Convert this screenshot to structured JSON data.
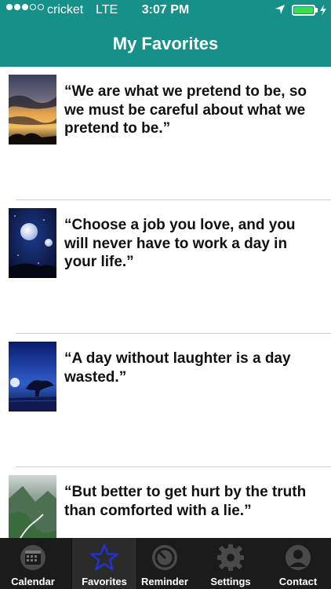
{
  "status_bar": {
    "carrier": "cricket",
    "network": "LTE",
    "time": "3:07 PM",
    "signal_bars_filled": 3,
    "signal_bars_total": 5,
    "battery_level": 1.0,
    "battery_color": "#38e04a"
  },
  "header": {
    "title": "My Favorites",
    "background_color": "#16918a"
  },
  "favorites": [
    {
      "quote": "“We are what we pretend to be, so we must be careful about what we pretend to be.”",
      "image": "sunset-clouds-image"
    },
    {
      "quote": "“Choose a job you love, and you will never have to work a day in your life.”",
      "image": "night-moons-image"
    },
    {
      "quote": "“A day without laughter is a day wasted.”",
      "image": "moonlit-tree-image"
    },
    {
      "quote": "“But better to get hurt by the truth than comforted with a lie.”",
      "image": "mountain-valley-image"
    }
  ],
  "tabbar": {
    "tabs": [
      {
        "label": "Calendar",
        "icon": "calendar-icon",
        "active": false
      },
      {
        "label": "Favorites",
        "icon": "star-icon",
        "active": true
      },
      {
        "label": "Reminder",
        "icon": "timer-icon",
        "active": false
      },
      {
        "label": "Settings",
        "icon": "gear-icon",
        "active": false
      },
      {
        "label": "Contact",
        "icon": "person-icon",
        "active": false
      }
    ],
    "active_icon_color": "#2233cc"
  }
}
